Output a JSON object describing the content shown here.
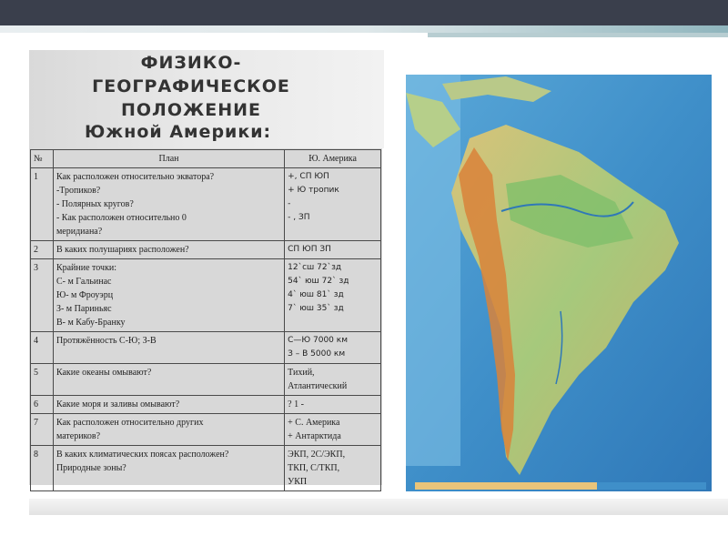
{
  "title": "ФИЗИКО-ГЕОГРАФИЧЕСКОЕ ПОЛОЖЕНИЕ",
  "subtitle": "Южной Америки:",
  "table": {
    "headers": [
      "№",
      "План",
      "Ю. Америка"
    ],
    "rows": [
      {
        "num": "1",
        "plan": [
          "Как расположен относительно экватора?",
          " -Тропиков?",
          "- Полярных кругов?",
          "- Как расположен относительно 0",
          "меридиана?"
        ],
        "answer": [
          " +, СП ЮП",
          "+ Ю тропик",
          "-",
          "- , ЗП"
        ]
      },
      {
        "num": "2",
        "plan": [
          "В каких полушариях расположен?"
        ],
        "answer": [
          " СП ЮП ЗП"
        ]
      },
      {
        "num": "3",
        "plan": [
          "Крайние точки:",
          "С- м Гальинас",
          "Ю- м Фроуэрц",
          "З- м Париньяс",
          "В- м Кабу-Бранку"
        ],
        "answer": [
          "",
          "12`сш 72`зд",
          "54` юш 72` зд",
          "4` юш 81` зд",
          "7` юш 35` зд"
        ]
      },
      {
        "num": "4",
        "plan": [
          "Протяжённость С-Ю; З-В"
        ],
        "answer": [
          "С—Ю  7000 км",
          "З – В  5000 км"
        ]
      },
      {
        "num": "5",
        "plan": [
          "Какие океаны омывают?"
        ],
        "answer": [
          " Тихий,",
          "Атлантический"
        ]
      },
      {
        "num": "6",
        "plan": [
          "Какие моря и заливы омывают?"
        ],
        "answer": [
          " ? 1 -"
        ]
      },
      {
        "num": "7",
        "plan": [
          "Как расположен относительно других",
          "материков?"
        ],
        "answer": [
          " + С. Америка",
          "+ Антарктида"
        ]
      },
      {
        "num": "8",
        "plan": [
          "В каких климатических поясах расположен?",
          "Природные зоны?"
        ],
        "answer": [
          " ЭКП, 2С/ЭКП,",
          "ТКП, С/ТКП,",
          "УКП"
        ]
      }
    ]
  },
  "map": {
    "type": "physical-map-south-america"
  }
}
